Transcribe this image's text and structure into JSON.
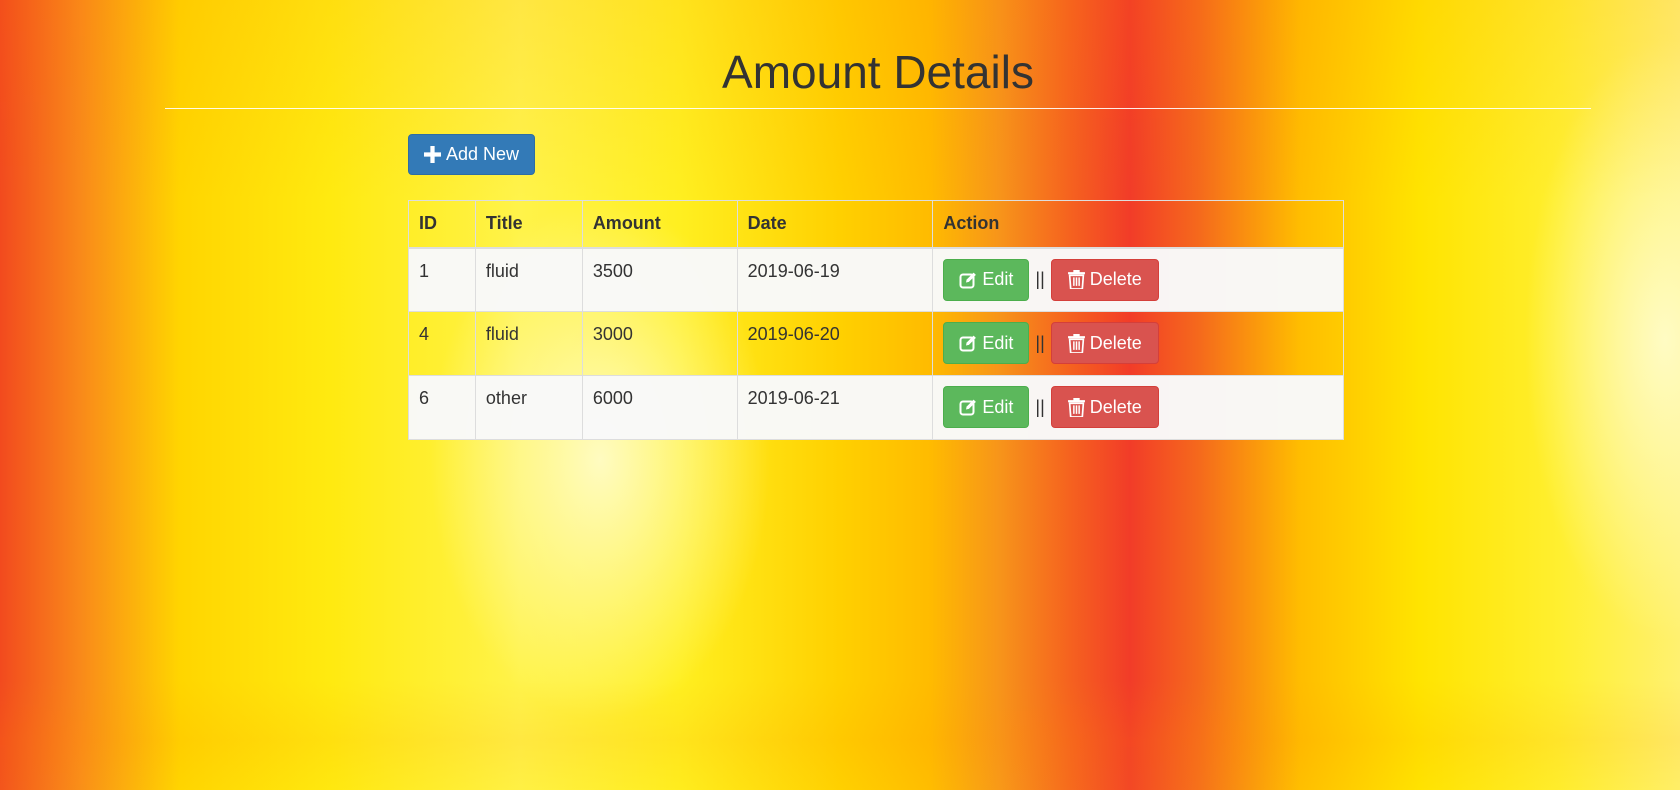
{
  "page": {
    "title": "Amount Details"
  },
  "toolbar": {
    "add_label": "Add New",
    "add_icon": "plus-icon"
  },
  "table": {
    "headers": [
      "ID",
      "Title",
      "Amount",
      "Date",
      "Action"
    ],
    "rows": [
      {
        "id": "1",
        "title": "fluid",
        "amount": "3500",
        "date": "2019-06-19"
      },
      {
        "id": "4",
        "title": "fluid",
        "amount": "3000",
        "date": "2019-06-20"
      },
      {
        "id": "6",
        "title": "other",
        "amount": "6000",
        "date": "2019-06-21"
      }
    ],
    "edit_label": "Edit",
    "delete_label": "Delete",
    "separator": "||"
  },
  "colors": {
    "primary": "#337ab7",
    "success": "#5cb85c",
    "danger": "#d9534f"
  }
}
